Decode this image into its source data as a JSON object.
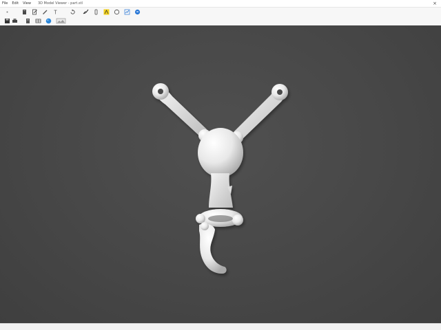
{
  "menu": {
    "file": "File",
    "edit": "Edit",
    "view": "View",
    "document_title": "3D Model Viewer - part.stl"
  },
  "window": {
    "close_symbol": "×"
  },
  "toolbar_row1": [
    {
      "name": "select-icon"
    },
    {
      "name": "book-icon"
    },
    {
      "name": "edit-page-icon"
    },
    {
      "name": "pencil-icon"
    },
    {
      "name": "text-tool-icon"
    },
    {
      "name": "rotate-icon"
    },
    {
      "name": "move-icon"
    },
    {
      "name": "measure-icon"
    },
    {
      "name": "device-icon"
    },
    {
      "name": "highlight-icon"
    },
    {
      "name": "circle-icon"
    },
    {
      "name": "chart-edit-icon"
    },
    {
      "name": "globe-icon"
    }
  ],
  "toolbar_row2": [
    {
      "name": "save-icon"
    },
    {
      "name": "print-icon"
    },
    {
      "name": "page-icon"
    },
    {
      "name": "layers-icon"
    },
    {
      "name": "sphere-icon"
    },
    {
      "name": "image-icon"
    }
  ],
  "colors": {
    "viewport_background": "#4a4a4a",
    "model_fill": "#efefef",
    "model_shadow": "#b9b9b9",
    "highlight_yellow": "#f3d21c",
    "accent_blue": "#2a78d6"
  },
  "viewport": {
    "model_name": "bone-skeleton-model"
  }
}
